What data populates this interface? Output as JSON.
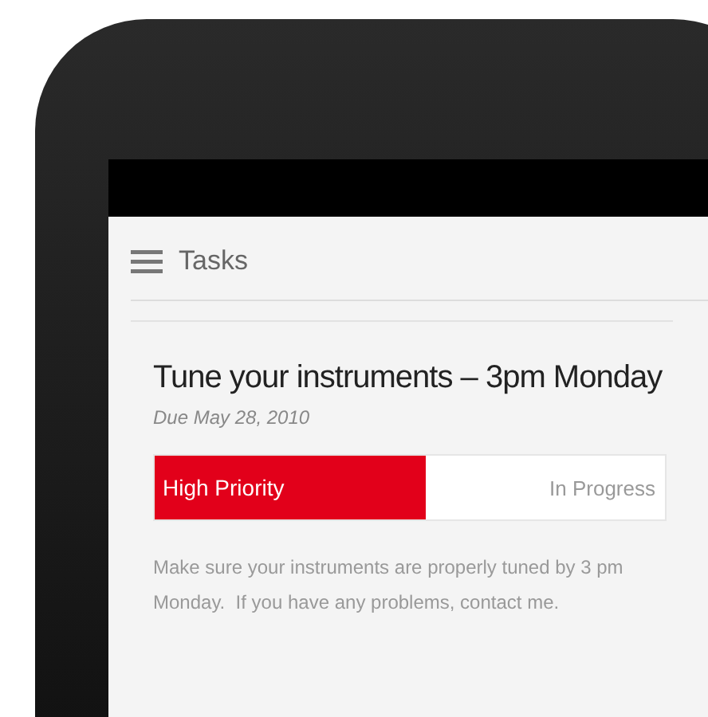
{
  "app_bar": {
    "title": "Tasks"
  },
  "task": {
    "title": "Tune your instruments – 3pm Monday",
    "due": "Due May 28, 2010",
    "priority": {
      "label": "High Priority",
      "level": 0.53
    },
    "status": "In Progress",
    "description": "Make sure your instruments are properly tuned by 3 pm Monday.  If you have any problems, contact me."
  }
}
